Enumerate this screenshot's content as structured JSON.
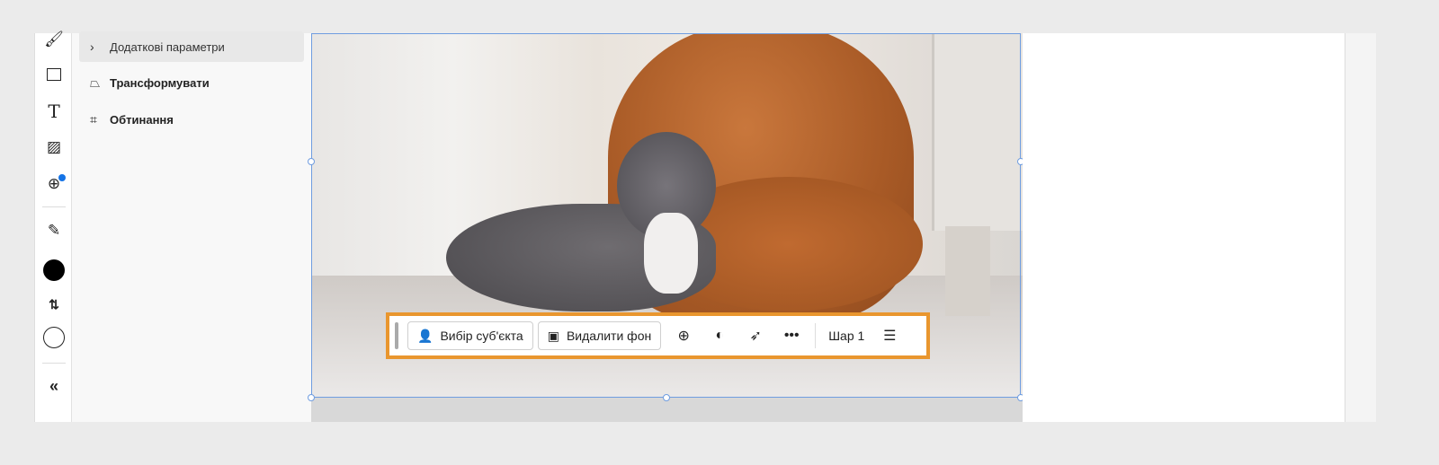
{
  "panel": {
    "more_options": "Додаткові параметри",
    "transform": "Трансформувати",
    "crop": "Обтинання"
  },
  "context_bar": {
    "select_subject": "Вибір суб'єкта",
    "remove_background": "Видалити фон",
    "layer": "Шар 1"
  },
  "colors": {
    "accent": "#e9962e",
    "selection": "#6f9de0",
    "notification": "#1473e6"
  }
}
